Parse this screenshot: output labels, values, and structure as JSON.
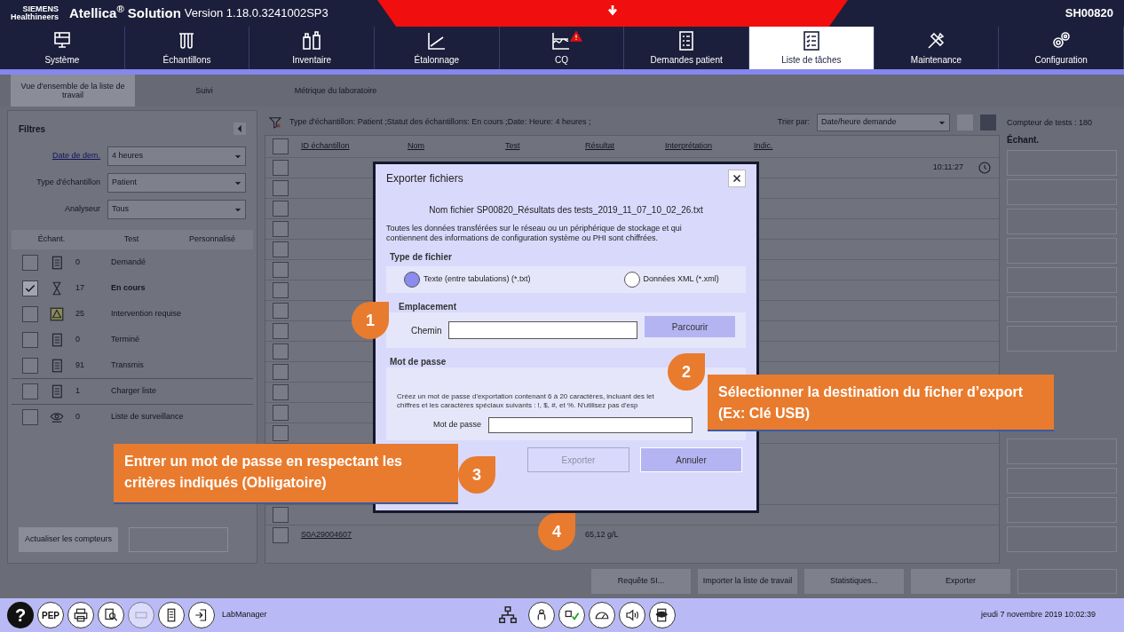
{
  "header": {
    "brand_top": "SIEMENS",
    "brand_bottom": "Healthineers",
    "product": "Atellica$^{®}$ Solution",
    "version": "Version 1.18.0.3241002SP3",
    "system_id": "SH00820"
  },
  "nav_tabs": [
    {
      "label": "Système",
      "kind": "system",
      "selected": false,
      "alert": false
    },
    {
      "label": "Échantillons",
      "kind": "samples",
      "selected": false,
      "alert": false
    },
    {
      "label": "Inventaire",
      "kind": "inventory",
      "selected": false,
      "alert": false
    },
    {
      "label": "Étalonnage",
      "kind": "calibration",
      "selected": false,
      "alert": false
    },
    {
      "label": "CQ",
      "kind": "qc",
      "selected": false,
      "alert": true
    },
    {
      "label": "Demandes patient",
      "kind": "orders",
      "selected": false,
      "alert": false
    },
    {
      "label": "Liste de tâches",
      "kind": "worklist",
      "selected": true,
      "alert": false
    },
    {
      "label": "Maintenance",
      "kind": "tools",
      "selected": false,
      "alert": false
    },
    {
      "label": "Configuration",
      "kind": "gears",
      "selected": false,
      "alert": false
    }
  ],
  "subtabs": [
    {
      "label": "Vue d'ensemble de la liste de travail",
      "selected": true
    },
    {
      "label": "Suivi",
      "selected": false
    },
    {
      "label": "Métrique du laboratoire",
      "selected": false
    }
  ],
  "filters": {
    "title": "Filtres",
    "fields": [
      {
        "label": "Date de dem.",
        "kind": "link",
        "value": "4 heures"
      },
      {
        "label": "Type d'échantillon",
        "kind": "plain",
        "value": "Patient"
      },
      {
        "label": "Analyseur",
        "kind": "plain",
        "value": "Tous"
      }
    ]
  },
  "status_columns": [
    "Échant.",
    "Test",
    "Personnalisé"
  ],
  "statuses": [
    {
      "count": "0",
      "label": "Demandé",
      "checked": false,
      "kind": "list"
    },
    {
      "count": "17",
      "label": "En cours",
      "checked": true,
      "kind": "hourglass"
    },
    {
      "count": "25",
      "label": "Intervention requise",
      "checked": false,
      "kind": "warning"
    },
    {
      "count": "0",
      "label": "Terminé",
      "checked": false,
      "kind": "list"
    },
    {
      "count": "91",
      "label": "Transmis",
      "checked": false,
      "kind": "list"
    },
    {
      "count": "1",
      "label": "Charger liste",
      "checked": false,
      "kind": "list"
    },
    {
      "count": "0",
      "label": "Liste de surveillance",
      "checked": false,
      "kind": "eye"
    }
  ],
  "left_buttons": [
    {
      "label": "Actualiser les compteurs",
      "disabled": false
    },
    {
      "disabled": true
    }
  ],
  "table": {
    "filter_summary": "Type d'échantillon: Patient ;Statut des échantillons: En cours ;Date: Heure: 4 heures ;",
    "sort_label": "Trier par:",
    "sort_value": "Date/heure demande",
    "select_all_checked": false,
    "columns": [
      "ID échantillon",
      "Nom",
      "Test",
      "Résultat",
      "Interprétation",
      "Indic."
    ],
    "rows": [
      {
        "checked": false,
        "time": "10:11:27"
      },
      {
        "checked": false
      },
      {
        "checked": false
      },
      {
        "checked": false
      },
      {
        "checked": false
      },
      {
        "checked": false
      },
      {
        "checked": false
      },
      {
        "checked": false
      },
      {
        "checked": false
      },
      {
        "checked": false
      },
      {
        "checked": false
      },
      {
        "checked": false
      },
      {
        "checked": false
      },
      {
        "checked": false
      },
      {
        "checked": false
      },
      {
        "checked": false,
        "sample_id": "S0A29004607",
        "result": "65,12 g/L"
      }
    ]
  },
  "right_panel": {
    "counter": "Compteur de tests : 180",
    "section": "Échant.",
    "buttons": [
      {
        "disabled": true
      },
      {
        "disabled": true
      },
      {
        "disabled": true
      },
      {
        "disabled": true
      },
      {
        "disabled": true
      },
      {
        "disabled": true
      },
      {
        "disabled": true
      },
      {
        "disabled": true
      },
      {
        "disabled": true
      },
      {
        "disabled": true
      },
      {
        "disabled": true
      }
    ]
  },
  "footer_buttons": [
    {
      "label": "Requête SI...",
      "disabled": false
    },
    {
      "label": "Importer la liste de travail",
      "disabled": false
    },
    {
      "label": "Statistiques...",
      "disabled": false
    },
    {
      "label": "Exporter",
      "disabled": false
    },
    {
      "disabled": true
    }
  ],
  "taskbar": {
    "left": [
      {
        "kind": "help",
        "text": "?"
      },
      {
        "kind": "pep",
        "text": "PEP"
      },
      {
        "kind": "printer"
      },
      {
        "kind": "search"
      },
      {
        "kind": "blank"
      },
      {
        "kind": "list"
      },
      {
        "kind": "logout"
      }
    ],
    "app": "LabManager",
    "center": [
      {
        "kind": "network"
      },
      {
        "kind": "person"
      },
      {
        "kind": "status"
      },
      {
        "kind": "gauge"
      },
      {
        "kind": "sound"
      },
      {
        "kind": "viewer"
      }
    ],
    "datetime": "jeudi 7 novembre 2019 10:02:39"
  },
  "dialog": {
    "title": "Exporter fichiers",
    "filename": "Nom fichier SP00820_Résultats des tests_2019_11_07_10_02_26.txt",
    "notice": "Toutes les données transférées sur le réseau ou un périphérique de stockage et qui contiennent des informations de configuration système ou PHI sont chiffrées.",
    "file_type": {
      "heading": "Type de fichier",
      "options": [
        {
          "label": "Texte (entre tabulations) (*.txt)",
          "selected": true
        },
        {
          "label": "Données XML (*.xml)",
          "selected": false
        }
      ]
    },
    "location": {
      "heading": "Emplacement",
      "field_label": "Chemin",
      "browse": "Parcourir"
    },
    "password": {
      "heading": "Mot de passe",
      "hint_lines": [
        "Créez un mot de passe d'exportation contenant 6 à 20 caractères, incluant des let",
        "chiffres et les caractères spéciaux suivants : !, $, #, et %. N'utilisez pas d'esp"
      ],
      "field_label": "Mot de passe"
    },
    "buttons": [
      {
        "label": "Exporter",
        "disabled": true
      },
      {
        "label": "Annuler",
        "disabled": false
      }
    ]
  },
  "callouts": [
    {
      "number": "1"
    },
    {
      "number": "2",
      "text": "Sélectionner la destination du ficher d’export (Ex: Clé USB)"
    },
    {
      "number": "3",
      "text": "Entrer un mot de passe en respectant les critères indiqués (Obligatoire)"
    },
    {
      "number": "4"
    }
  ]
}
